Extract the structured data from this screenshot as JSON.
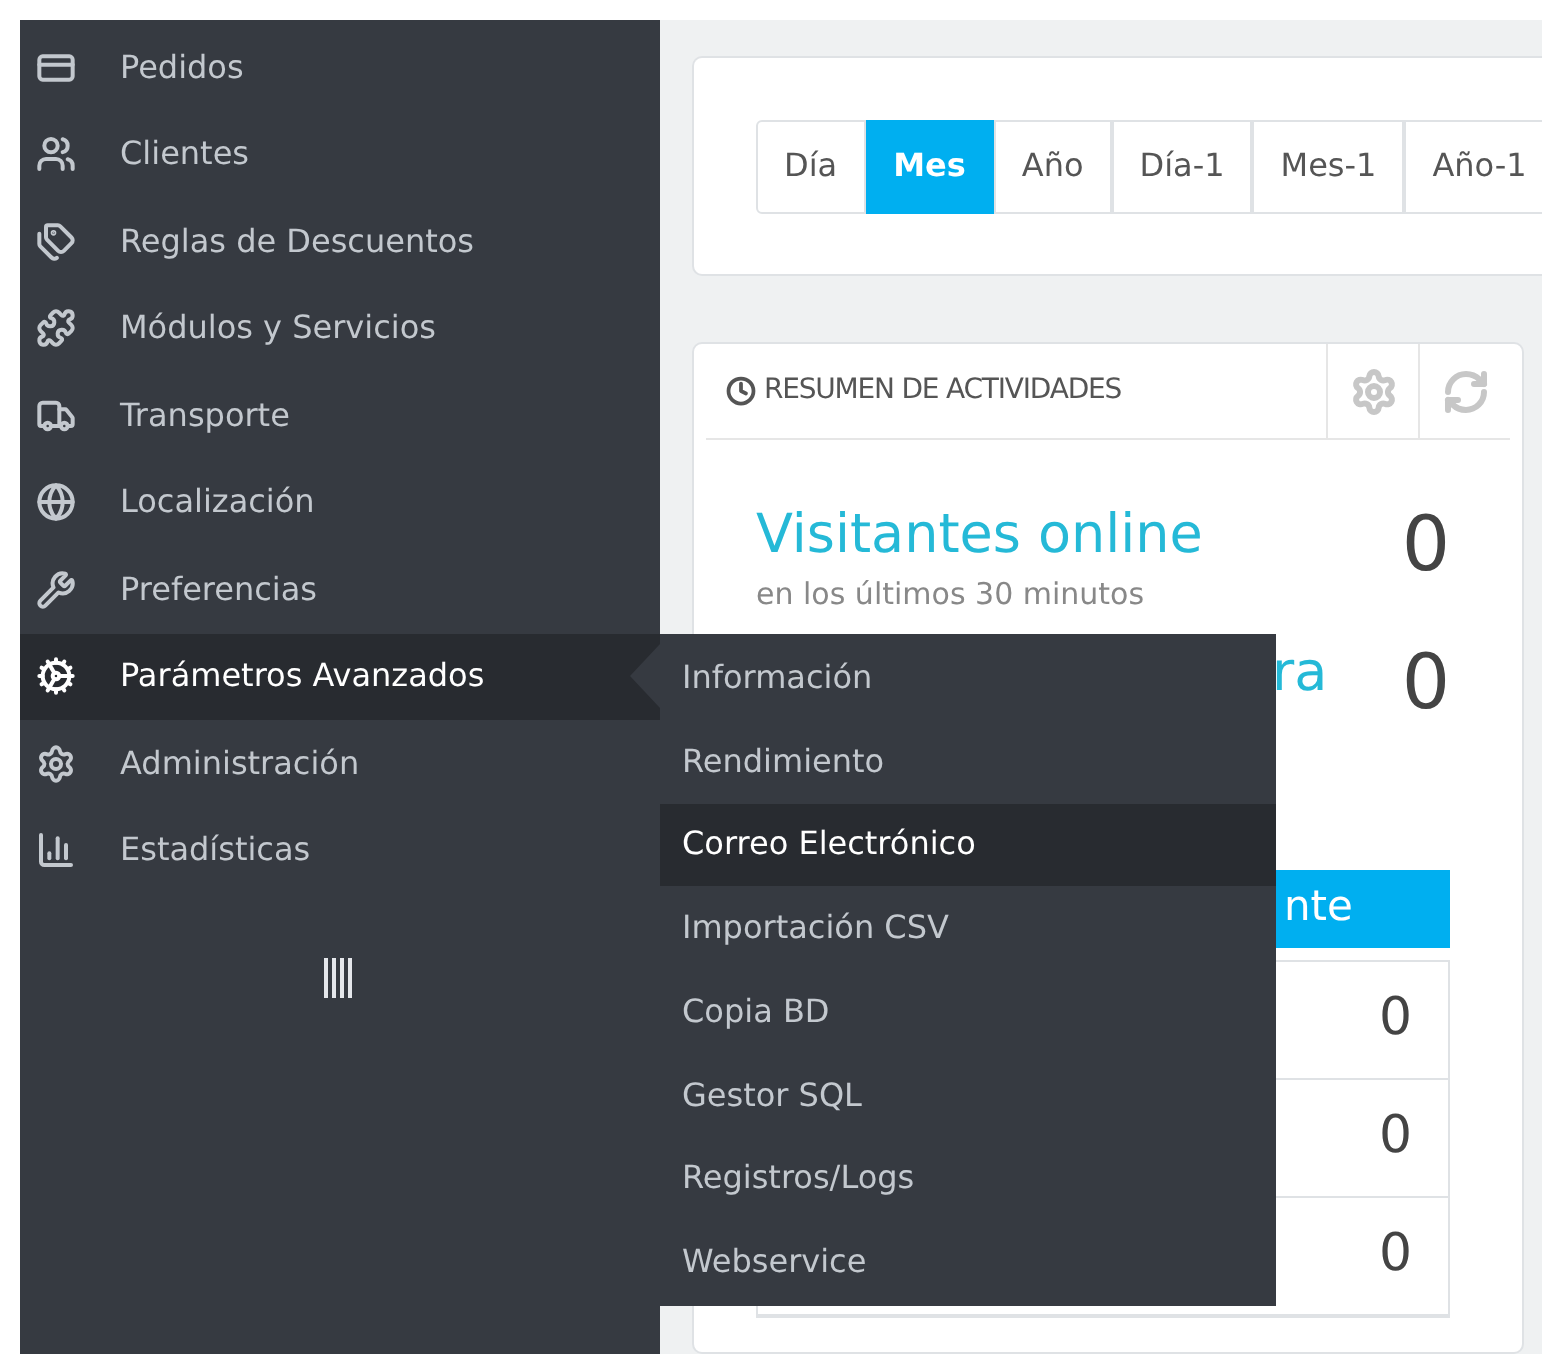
{
  "sidebar": {
    "items": [
      {
        "label": "Pedidos",
        "selected": false
      },
      {
        "label": "Clientes",
        "selected": false
      },
      {
        "label": "Reglas de Descuentos",
        "selected": false
      },
      {
        "label": "Módulos y Servicios",
        "selected": false
      },
      {
        "label": "Transporte",
        "selected": false
      },
      {
        "label": "Localización",
        "selected": false
      },
      {
        "label": "Preferencias",
        "selected": false
      },
      {
        "label": "Parámetros Avanzados",
        "selected": true
      },
      {
        "label": "Administración",
        "selected": false
      },
      {
        "label": "Estadísticas",
        "selected": false
      }
    ]
  },
  "submenu": {
    "items": [
      {
        "label": "Información",
        "selected": false
      },
      {
        "label": "Rendimiento",
        "selected": false
      },
      {
        "label": "Correo Electrónico",
        "selected": true
      },
      {
        "label": "Importación CSV",
        "selected": false
      },
      {
        "label": "Copia BD",
        "selected": false
      },
      {
        "label": "Gestor SQL",
        "selected": false
      },
      {
        "label": "Registros/Logs",
        "selected": false
      },
      {
        "label": "Webservice",
        "selected": false
      }
    ]
  },
  "period_buttons": [
    {
      "label": "Día",
      "selected": false
    },
    {
      "label": "Mes",
      "selected": true
    },
    {
      "label": "Año",
      "selected": false
    },
    {
      "label": "Día-1",
      "selected": false
    },
    {
      "label": "Mes-1",
      "selected": false
    },
    {
      "label": "Año-1",
      "selected": false
    }
  ],
  "activity_card": {
    "title": "RESUMEN DE ACTIVIDADES",
    "metrics": [
      {
        "label": "Visitantes online",
        "sublabel": "en los últimos 30 minutos",
        "value": "0"
      },
      {
        "label": "ra",
        "value": "0"
      }
    ],
    "tab": {
      "label": "nte"
    },
    "rows": [
      {
        "value": "0"
      },
      {
        "value": "0"
      },
      {
        "value": "0"
      }
    ]
  }
}
